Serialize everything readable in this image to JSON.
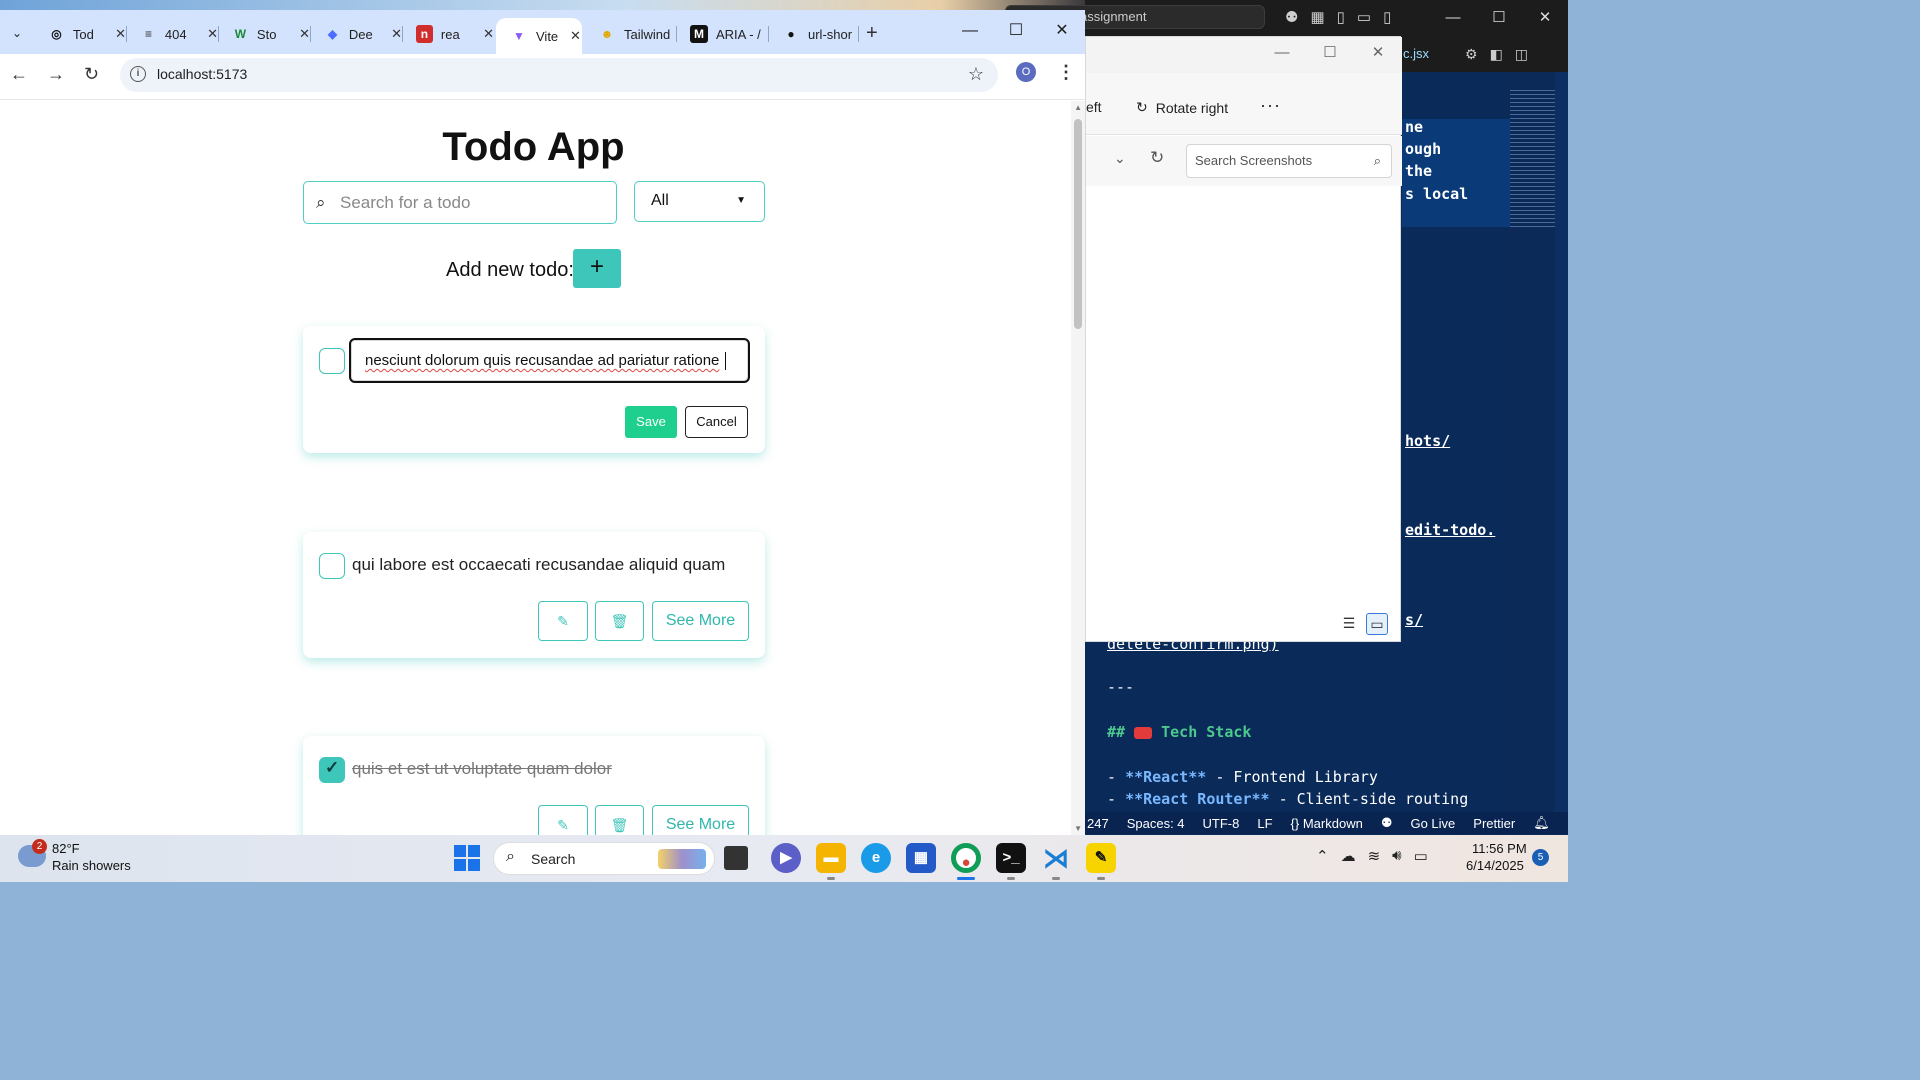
{
  "vscode": {
    "search_text": "alt-school-assignment",
    "tab_file": "c.jsx",
    "highlight_lines": [
      "ne",
      "ough",
      "the",
      "s local"
    ],
    "link_lines": [
      "hots/",
      "edit-todo.",
      "s/"
    ],
    "partial_link": "delete-confirm.png)",
    "separator": "---",
    "heading": "Tech Stack",
    "heading_prefix": "##",
    "list_items": [
      {
        "bullet": "-",
        "bold": "**React**",
        "rest": " - Frontend Library"
      },
      {
        "bullet": "-",
        "bold": "**React Router**",
        "rest": " - Client-side routing"
      }
    ],
    "status": [
      "247",
      "Spaces: 4",
      "UTF-8",
      "LF",
      "{} Markdown",
      "Go Live",
      "Prettier"
    ]
  },
  "photos": {
    "left_partial": "eft",
    "rotate_label": "Rotate right",
    "more_label": "···",
    "search_placeholder": "Search Screenshots"
  },
  "chrome": {
    "tabs": [
      {
        "label": "Tod",
        "icon": "openai-icon"
      },
      {
        "label": "404",
        "icon": "page-icon"
      },
      {
        "label": "Sto",
        "icon": "w-icon"
      },
      {
        "label": "Dee",
        "icon": "deepseek-icon"
      },
      {
        "label": "rea",
        "icon": "netlify-icon"
      },
      {
        "label": "Vite",
        "icon": "vite-icon"
      },
      {
        "label": "Tailwind",
        "icon": "smiley-icon"
      },
      {
        "label": "ARIA - /",
        "icon": "m-icon"
      },
      {
        "label": "url-shor",
        "icon": "github-icon"
      }
    ],
    "url": "localhost:5173",
    "profile_initial": "O"
  },
  "app": {
    "title": "Todo App",
    "search_placeholder": "Search for a todo",
    "filter_value": "All",
    "add_label": "Add new todo:",
    "add_button": "+",
    "editing": {
      "value": "nesciunt dolorum quis recusandae ad pariatur ratione",
      "save": "Save",
      "cancel": "Cancel"
    },
    "todos": [
      {
        "text": "qui labore est occaecati recusandae aliquid quam",
        "completed": false,
        "see_more": "See More"
      },
      {
        "text": "quis et est ut voluptate quam dolor",
        "completed": true,
        "see_more": "See More"
      }
    ]
  },
  "taskbar": {
    "weather_badge": "2",
    "temperature": "82°F",
    "weather_desc": "Rain showers",
    "search_label": "Search",
    "time": "11:56 PM",
    "date": "6/14/2025",
    "notifications": "5"
  },
  "colors": {
    "accent": "#3fc6bb",
    "save": "#1fcf8e",
    "vscode_bg": "#0b2a57",
    "chrome_tabstrip": "#d3e3fd"
  }
}
